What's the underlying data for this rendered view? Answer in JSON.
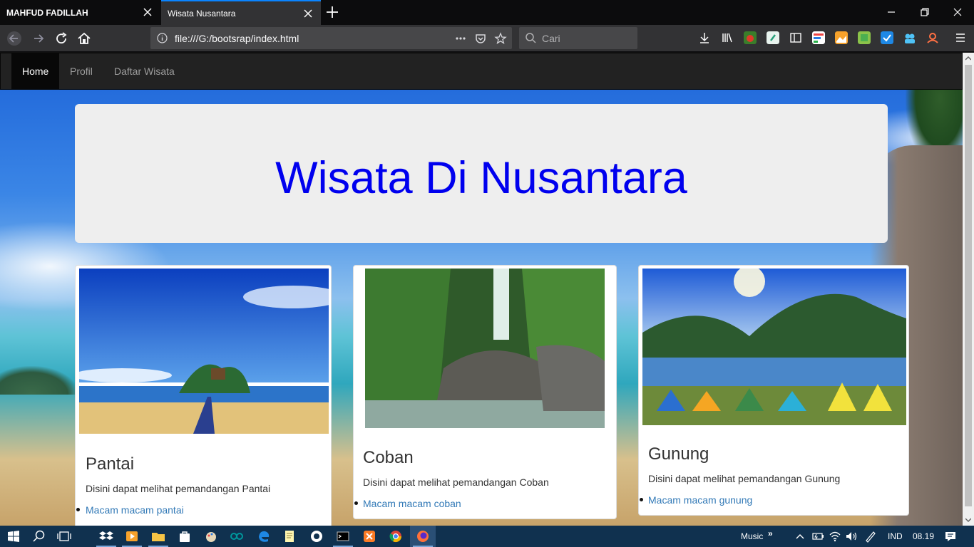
{
  "browser": {
    "tabs": [
      {
        "title": "MAHFUD FADILLAH"
      },
      {
        "title": "Wisata Nusantara"
      }
    ],
    "url": "file:///G:/bootsrap/index.html",
    "search_placeholder": "Cari"
  },
  "site": {
    "nav": [
      {
        "label": "Home"
      },
      {
        "label": "Profil"
      },
      {
        "label": "Daftar Wisata"
      }
    ],
    "heading": "Wisata Di Nusantara",
    "heading_color": "#0000ee",
    "cards": [
      {
        "title": "Pantai",
        "description": "Disini dapat melihat pemandangan Pantai",
        "link": "Macam macam pantai",
        "photo": "beach-photo"
      },
      {
        "title": "Coban",
        "description": "Disini dapat melihat pemandangan Coban",
        "link": "Macam macam coban",
        "photo": "waterfall-photo"
      },
      {
        "title": "Gunung",
        "description": "Disini dapat melihat pemandangan Gunung",
        "link": "Macam macam gunung",
        "photo": "mountain-lake-photo"
      }
    ]
  },
  "taskbar": {
    "music_label": "Music",
    "language": "IND",
    "clock": "08.19"
  },
  "colors": {
    "link": "#337ab7",
    "tab_accent": "#0a84ff",
    "navbar": "#222222",
    "taskbar": "#10314f"
  }
}
